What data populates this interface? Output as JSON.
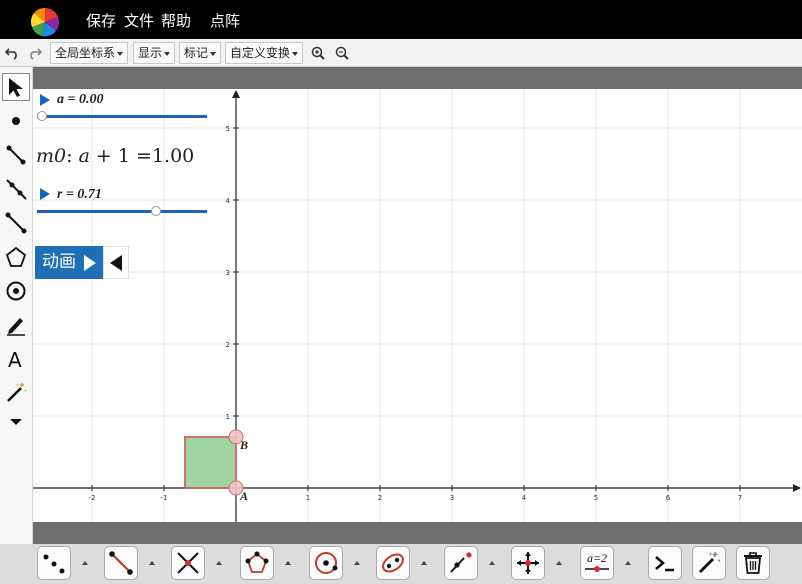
{
  "menu": {
    "items": [
      "保存",
      "文件",
      "帮助",
      "点阵"
    ]
  },
  "toolbar": {
    "undo_icon": "undo-icon",
    "redo_icon": "redo-icon",
    "coord_system": "全局坐标系",
    "display": "显示",
    "mark": "标记",
    "custom_transform": "自定义变换",
    "zoom_in_icon": "zoom-in-icon",
    "zoom_out_icon": "zoom-out-icon"
  },
  "left_tools": [
    "select-arrow-icon",
    "point-icon",
    "segment-icon",
    "ray-icon",
    "line-icon",
    "polygon-icon",
    "circle-icon",
    "pen-icon",
    "text-icon",
    "magic-wand-icon",
    "more-chevron-icon"
  ],
  "algebra": {
    "slider_a": {
      "label": "a = 0.00",
      "value": 0.0,
      "min": 0,
      "max": 1
    },
    "m0": {
      "name": "m0",
      "expr_var": "a",
      "expr_rest": " + 1 =",
      "value": "1.00"
    },
    "slider_r": {
      "label": "r = 0.71",
      "value": 0.71,
      "min": 0,
      "max": 1
    },
    "animate_label": "动画"
  },
  "graphics": {
    "x_ticks": [
      -2,
      -1,
      1,
      2,
      3,
      4,
      5,
      6,
      7
    ],
    "y_ticks": [
      1,
      2,
      3,
      4,
      5
    ],
    "points": [
      {
        "name": "A",
        "x": 0,
        "y": 0
      },
      {
        "name": "B",
        "x": 0,
        "y": 0.71
      }
    ],
    "square": {
      "x_min": -0.71,
      "x_max": 0,
      "y_min": 0,
      "y_max": 0.71
    },
    "colors": {
      "fill": "#9fd3a0",
      "stroke": "#d9383a",
      "point": "#f4c1c1",
      "grid": "#e6e6e6"
    }
  },
  "bottom_tools": [
    "points-tool-icon",
    "segment-tool-icon",
    "intersect-tool-icon",
    "polygon-tool-icon",
    "circle-tool-icon",
    "conic-tool-icon",
    "tangent-tool-icon",
    "move-graphics-tool-icon",
    "slider-tool-icon",
    "command-tool-icon",
    "magic-tool-icon",
    "trash-icon"
  ],
  "bottom_slider_label": "a=2"
}
